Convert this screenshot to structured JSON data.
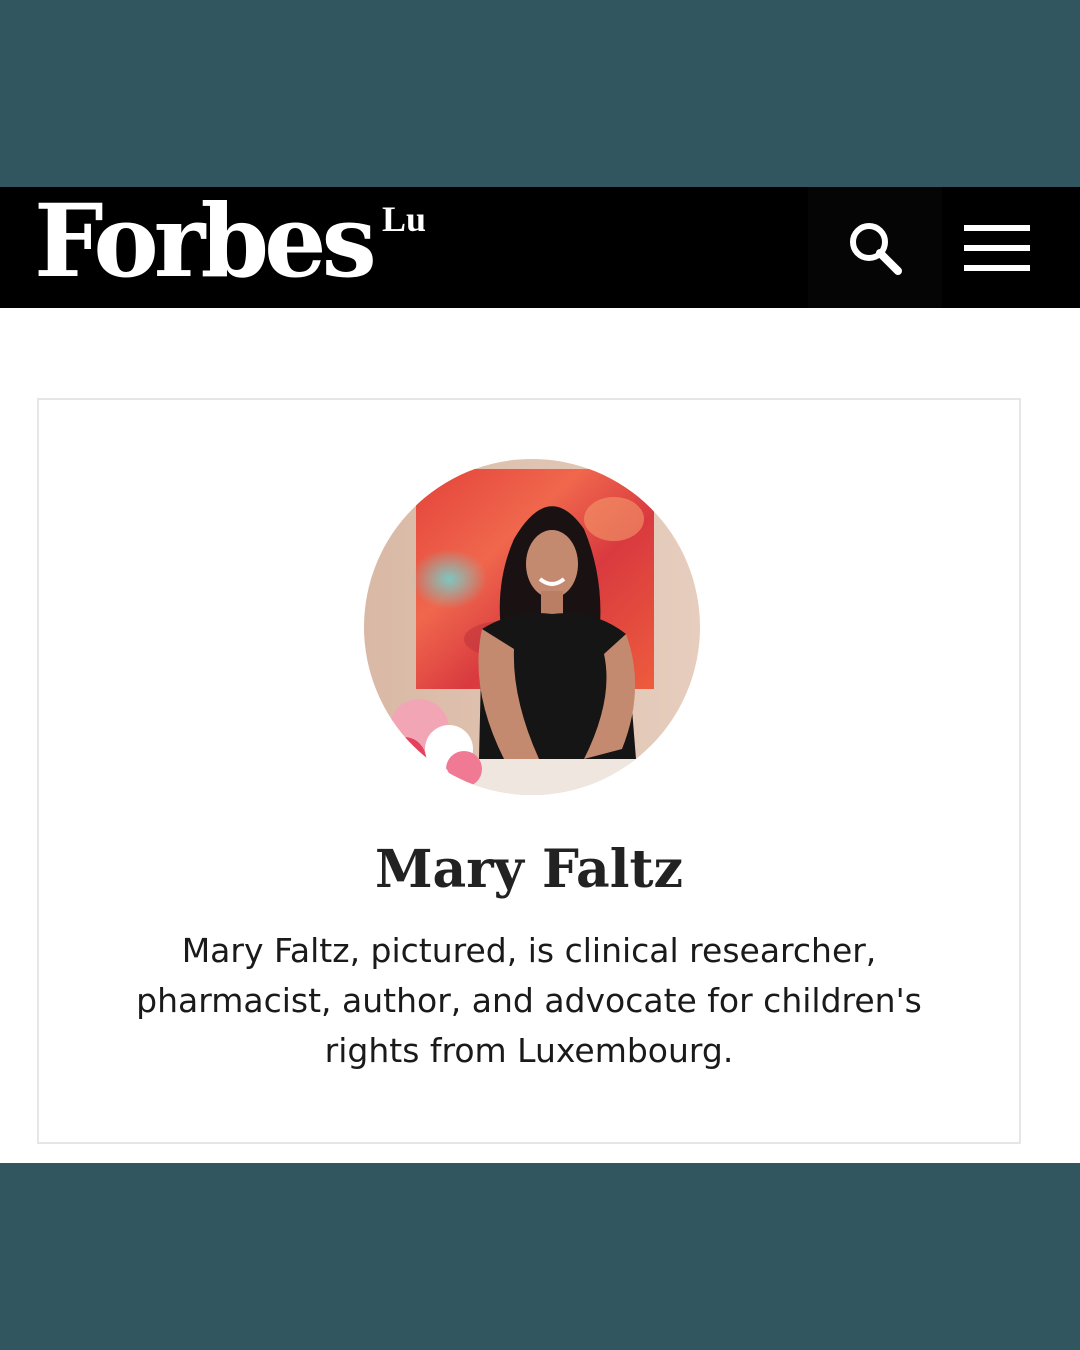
{
  "header": {
    "logo": "Forbes",
    "logo_suffix": "Lu",
    "search_icon": "search-icon",
    "menu_icon": "hamburger-menu-icon"
  },
  "profile": {
    "name": "Mary Faltz",
    "caption": "Mary Faltz, pictured, is clinical researcher, pharmacist, author, and advocate for children's rights from Luxembourg.",
    "photo_alt": "Portrait photo of Mary Faltz"
  },
  "colors": {
    "frame": "#32565f",
    "header_bg": "#000000",
    "page_bg": "#ffffff",
    "card_border": "#e6e6e6"
  }
}
